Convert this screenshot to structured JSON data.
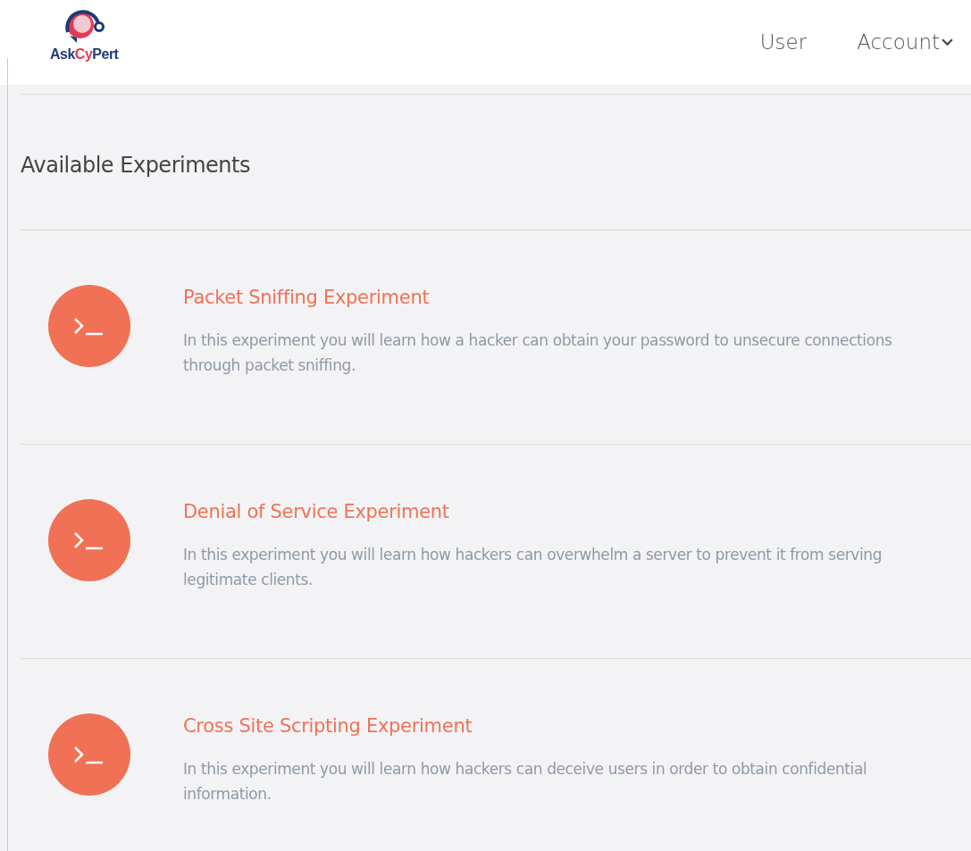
{
  "header": {
    "logo": [
      {
        "text": "Ask",
        "highlight": false
      },
      {
        "text": "Cy",
        "highlight": true
      },
      {
        "text": "Pert",
        "highlight": false
      }
    ],
    "nav": [
      {
        "label": "User",
        "dropdown": false
      },
      {
        "label": "Account",
        "dropdown": true
      }
    ]
  },
  "section_title": "Available Experiments",
  "experiments": [
    {
      "title": "Packet Sniffing Experiment",
      "description": "In this experiment you will learn how a hacker can obtain your password to unsecure connections through packet sniffing."
    },
    {
      "title": "Denial of Service Experiment",
      "description": "In this experiment you will learn how hackers can overwhelm a server to prevent it from serving legitimate clients."
    },
    {
      "title": "Cross Site Scripting Experiment",
      "description": "In this experiment you will learn how hackers can deceive users in order to obtain confidential information."
    }
  ]
}
